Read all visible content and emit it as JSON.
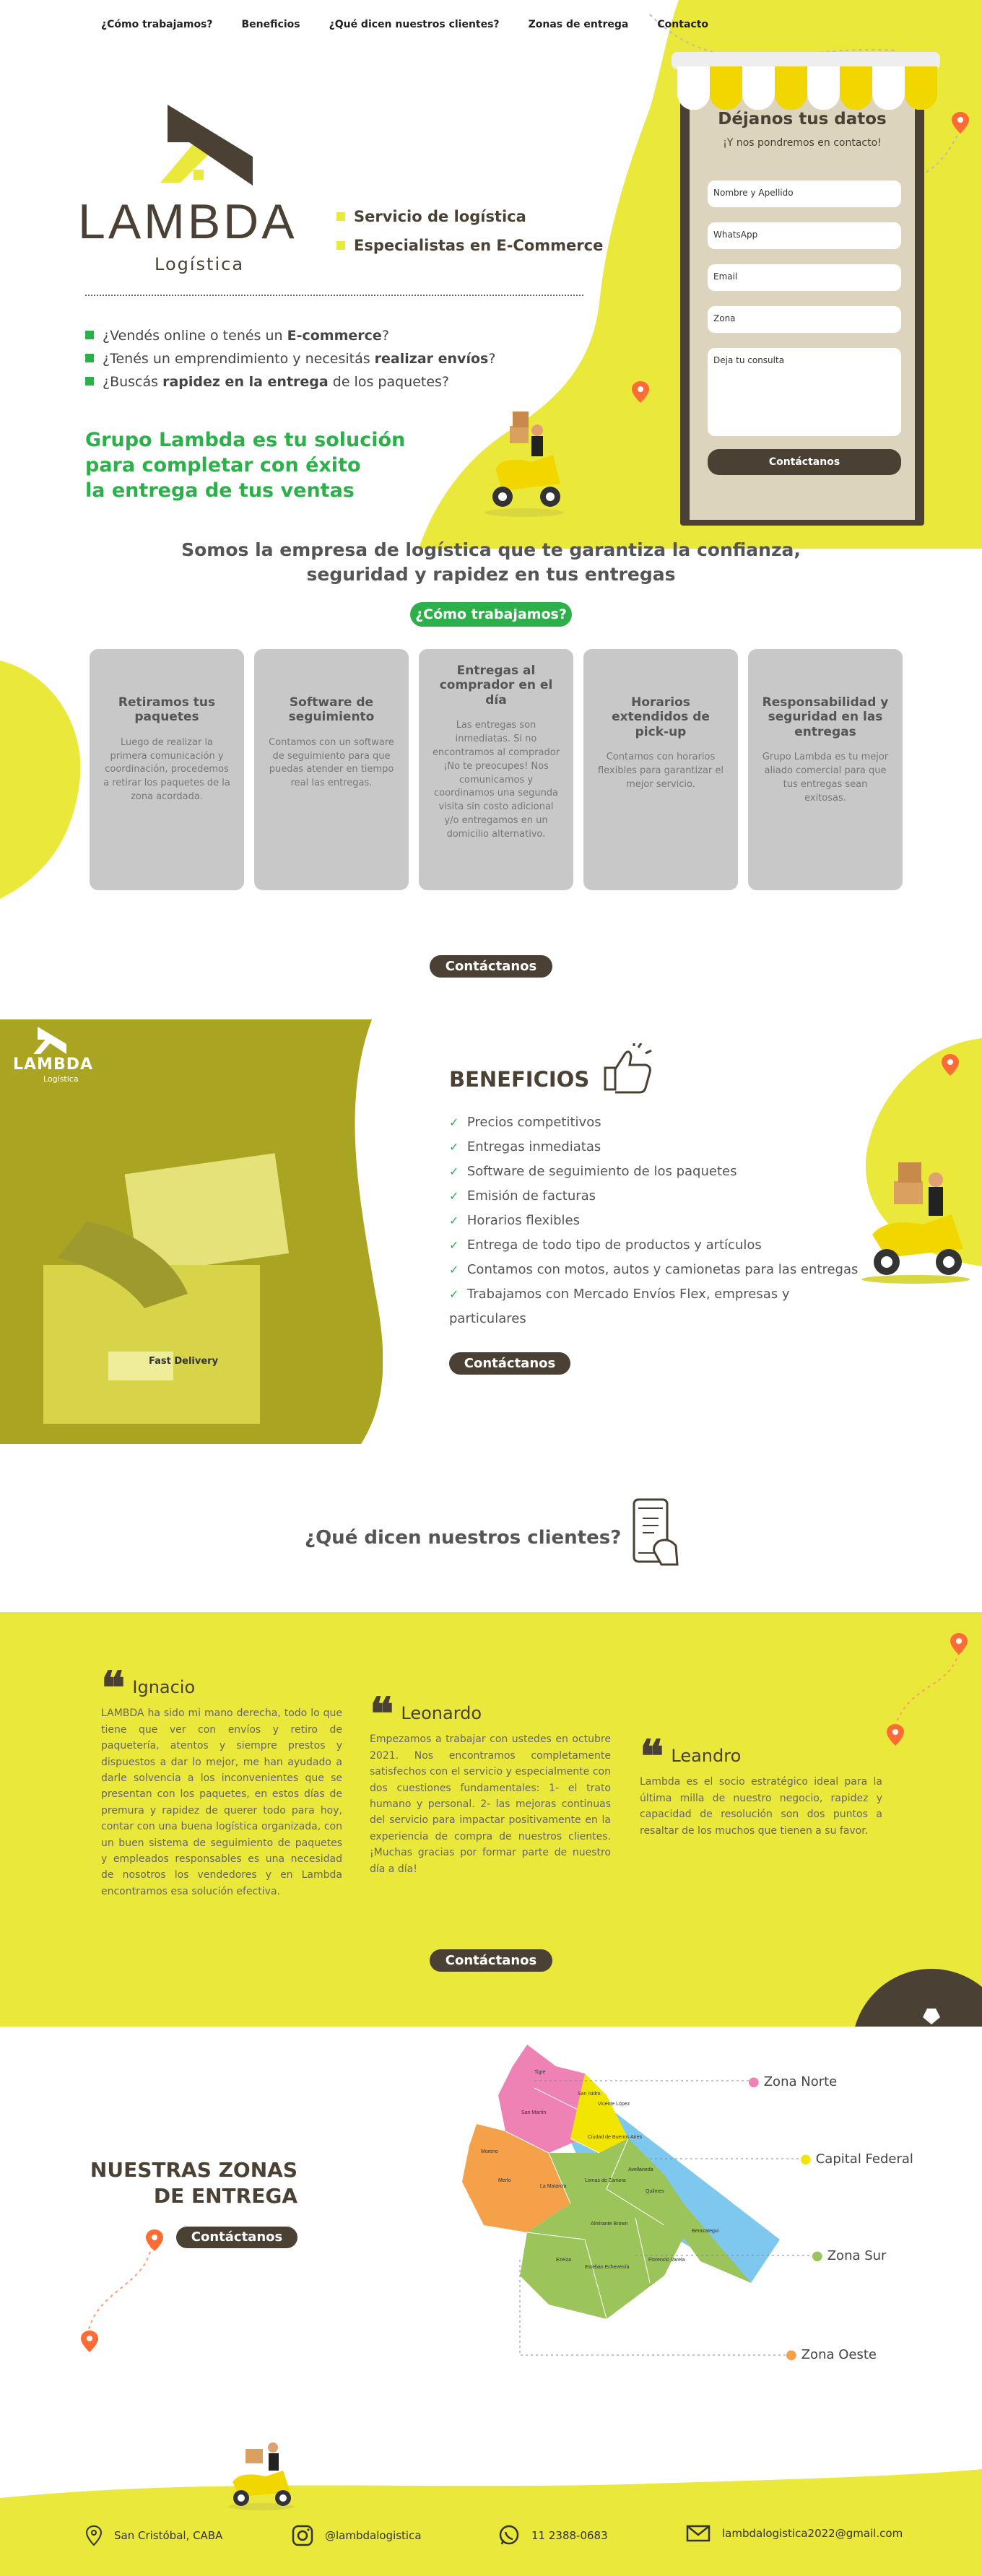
{
  "nav": {
    "items": [
      "¿Cómo trabajamos?",
      "Beneficios",
      "¿Qué dicen nuestros clientes?",
      "Zonas de entrega",
      "Contacto"
    ]
  },
  "brand": {
    "name": "LAMBDA",
    "sub": "Logística",
    "footer_name": "LAMBDA",
    "footer_sub": "Logística"
  },
  "hero": {
    "tag1": "Servicio de logística",
    "tag2": "Especialistas en E-Commerce",
    "q1_pre": "¿Vendés online o tenés un ",
    "q1_bold": "E-commerce",
    "q1_post": "?",
    "q2_pre": "¿Tenés un emprendimiento y necesitás ",
    "q2_bold": "realizar envíos",
    "q2_post": "?",
    "q3_pre": "¿Buscás ",
    "q3_bold": "rapidez en la entrega",
    "q3_post": " de los paquetes?",
    "solution_1": "Grupo Lambda es tu solución",
    "solution_2": "para completar con éxito",
    "solution_3": "la entrega de tus ventas"
  },
  "form": {
    "title": "Déjanos tus datos",
    "subtitle": "¡Y nos pondremos en contacto!",
    "name_ph": "Nombre y Apellido",
    "whatsapp_ph": "WhatsApp",
    "email_ph": "Email",
    "zona_ph": "Zona",
    "consulta_ph": "Deja tu consulta",
    "submit": "Contáctanos"
  },
  "about": {
    "line1": "Somos la empresa de logística que te garantiza la confianza,",
    "line2": "seguridad y rapidez en tus entregas",
    "badge": "¿Cómo trabajamos?",
    "cards": [
      {
        "title": "Retiramos tus paquetes",
        "text": "Luego de realizar la primera comunicación y coordinación, procedemos a retirar los paquetes de la zona acordada."
      },
      {
        "title": "Software de seguimiento",
        "text": "Contamos con un software de seguimiento para que puedas atender en tiempo real las entregas."
      },
      {
        "title": "Entregas al comprador en el día",
        "text": "Las entregas son inmediatas. Si no encontramos al comprador ¡No te preocupes! Nos comunicamos y coordinamos una segunda visita sin costo adicional y/o entregamos en un domicilio alternativo."
      },
      {
        "title": "Horarios extendidos de pick-up",
        "text": "Contamos con horarios flexibles para garantizar el mejor servicio."
      },
      {
        "title": "Responsabilidad y seguridad en las entregas",
        "text": "Grupo Lambda es tu mejor aliado comercial para que tus entregas sean exitosas."
      }
    ],
    "cta": "Contáctanos"
  },
  "benefits": {
    "title": "BENEFICIOS",
    "items": [
      "Precios competitivos",
      "Entregas inmediatas",
      "Software de seguimiento de los paquetes",
      "Emisión de facturas",
      "Horarios flexibles",
      "Entrega de todo tipo de productos y artículos",
      "Contamos con motos, autos y camionetas para las entregas",
      "Trabajamos con Mercado Envíos Flex, empresas y particulares"
    ],
    "cta": "Contáctanos",
    "box_label": "Fast Delivery"
  },
  "testimonials": {
    "title": "¿Qué dicen nuestros clientes?",
    "items": [
      {
        "name": "Ignacio",
        "text": "LAMBDA ha sido mi mano derecha, todo lo que tiene que ver con envíos y retiro de paquetería, atentos y siempre prestos y dispuestos a dar lo mejor, me han ayudado a darle solvencia a los inconvenientes que se presentan con los paquetes, en estos días de premura y rapidez de querer todo para hoy, contar con una buena logística organizada, con un buen sistema de seguimiento de paquetes y empleados responsables es una necesidad de nosotros los vendedores y en Lambda encontramos esa solución efectiva."
      },
      {
        "name": "Leonardo",
        "text": "Empezamos a trabajar con ustedes en octubre 2021. Nos encontramos completamente satisfechos con el servicio y especialmente con dos cuestiones fundamentales: 1- el trato humano y personal. 2- las mejoras continuas del servicio para impactar positivamente en la experiencia de compra de nuestros clientes. ¡Muchas gracias por formar parte de nuestro día a día!"
      },
      {
        "name": "Leandro",
        "text": "Lambda es el socio estratégico ideal para la última milla de nuestro negocio, rapidez y capacidad de resolución son dos puntos a resaltar de los muchos que tienen a su favor."
      }
    ],
    "cta": "Contáctanos"
  },
  "zones": {
    "title_1": "NUESTRAS ZONAS",
    "title_2": "DE ENTREGA",
    "cta": "Contáctanos",
    "labels": [
      "Zona Norte",
      "Capital Federal",
      "Zona Sur",
      "Zona Oeste"
    ],
    "towns": [
      "Tigre",
      "San Isidro",
      "Vicente López",
      "San Martín",
      "Moreno",
      "Merlo",
      "La Matanza",
      "Ezeiza",
      "Ciudad de Buenos Aires",
      "Avellaneda",
      "Quilmes",
      "Berazategui",
      "Florencio Varela",
      "Almirante Brown",
      "Esteban Echeverría",
      "Lomas de Zamora"
    ]
  },
  "colors": {
    "yellow": "#ebe83c",
    "dark": "#4a4033",
    "green": "#2bb04a",
    "orange": "#ff6b35",
    "gray_card": "#c8c8c8"
  },
  "footer": {
    "address": "San Cristóbal, CABA",
    "instagram": "@lambdalogistica",
    "phone": "11 2388-0683",
    "email": "lambdalogistica2022@gmail.com"
  }
}
